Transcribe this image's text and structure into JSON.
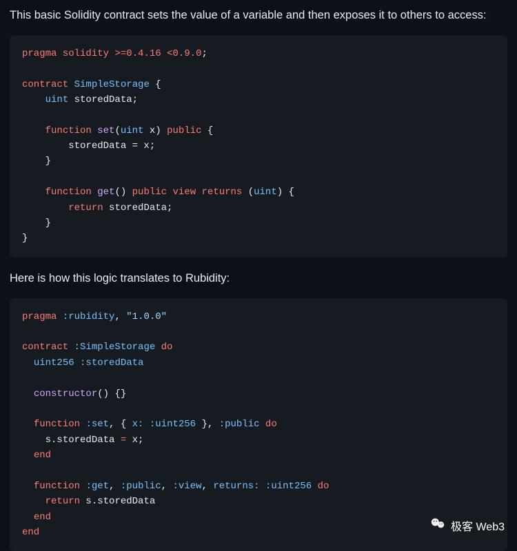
{
  "intro1": "This basic Solidity contract sets the value of a variable and then exposes it to others to access:",
  "intro2": "Here is how this logic translates to Rubidity:",
  "solidity": {
    "l1": {
      "pragma": "pragma",
      "solidity": "solidity",
      "ver1": ">=0.4.16",
      "ver2": "<0.9.0",
      "semi": ";"
    },
    "l2": {
      "contract": "contract",
      "name": "SimpleStorage",
      "brace": " {"
    },
    "l3": {
      "indent": "    ",
      "type": "uint",
      "id": " storedData;"
    },
    "l4": {
      "indent": "    ",
      "fn": "function",
      "name": " set",
      "p1": "(",
      "ptype": "uint",
      "pname": " x",
      "p2": ") ",
      "vis": "public",
      "brace": " {"
    },
    "l5": {
      "indent": "        ",
      "body": "storedData = x;"
    },
    "l6": {
      "indent": "    ",
      "close": "}"
    },
    "l7": {
      "indent": "    ",
      "fn": "function",
      "name": " get",
      "p1": "() ",
      "vis": "public",
      "sp1": " ",
      "view": "view",
      "sp2": " ",
      "ret": "returns",
      "p2": " (",
      "rt": "uint",
      "p3": ") {"
    },
    "l8": {
      "indent": "        ",
      "ret": "return",
      "body": " storedData;"
    },
    "l9": {
      "indent": "    ",
      "close": "}"
    },
    "l10": {
      "close": "}"
    }
  },
  "rubidity": {
    "l1": {
      "pragma": "pragma",
      "sp": " ",
      "sym": ":rubidity",
      "comma": ", ",
      "ver": "\"1.0.0\""
    },
    "l2": {
      "contract": "contract",
      "sp": " ",
      "sym": ":SimpleStorage",
      "sp2": " ",
      "do": "do"
    },
    "l3": {
      "indent": "  ",
      "type": "uint256",
      "sp": " ",
      "sym": ":storedData"
    },
    "l4": {
      "indent": "  ",
      "ctor": "constructor",
      "body": "() {}"
    },
    "l5": {
      "indent": "  ",
      "fn": "function",
      "sp": " ",
      "sym": ":set",
      "c1": ", { ",
      "x": "x:",
      "sp2": " ",
      "xt": ":uint256",
      "c2": " }, ",
      "vis": ":public",
      "sp3": " ",
      "do": "do"
    },
    "l6": {
      "indent": "    ",
      "body1": "s.storedData ",
      "op": "=",
      "body2": " x;"
    },
    "l7": {
      "indent": "  ",
      "end": "end"
    },
    "l8": {
      "indent": "  ",
      "fn": "function",
      "sp": " ",
      "sym": ":get",
      "c1": ", ",
      "vis": ":public",
      "c2": ", ",
      "view": ":view",
      "c3": ", ",
      "retk": "returns:",
      "sp2": " ",
      "rt": ":uint256",
      "sp3": " ",
      "do": "do"
    },
    "l9": {
      "indent": "    ",
      "ret": "return",
      "body": " s.storedData"
    },
    "l10": {
      "indent": "  ",
      "end": "end"
    },
    "l11": {
      "end": "end"
    }
  },
  "watermark": "极客 Web3"
}
